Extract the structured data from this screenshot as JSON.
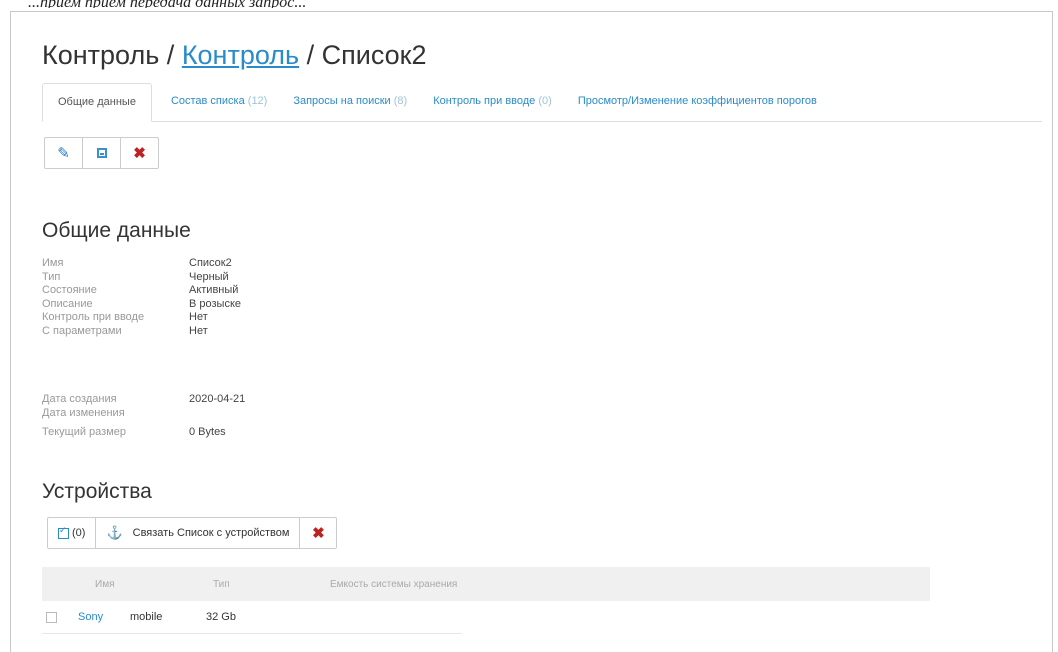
{
  "header_caption": "...прием прием передача данных запрос...",
  "breadcrumb": {
    "part1": "Контроль /",
    "link": "Контроль",
    "part3": "/ Список2"
  },
  "tabs": [
    {
      "label": "Общие данные",
      "count": ""
    },
    {
      "label": "Состав списка",
      "count": "(12)"
    },
    {
      "label": "Запросы на поиски",
      "count": "(8)"
    },
    {
      "label": "Контроль при вводе",
      "count": "(0)"
    },
    {
      "label": "Просмотр/Изменение коэффициентов порогов",
      "count": ""
    }
  ],
  "toolbar": {
    "edit_icon": "pencil-icon",
    "save_icon": "save-icon",
    "delete_icon": "close-icon"
  },
  "general": {
    "title": "Общие данные",
    "props": [
      {
        "key": "Имя",
        "value": "Список2"
      },
      {
        "key": "Тип",
        "value": "Черный"
      },
      {
        "key": "Состояние",
        "value": "Активный"
      },
      {
        "key": "Описание",
        "value": "В розыске"
      },
      {
        "key": "Контроль при вводе",
        "value": "Нет"
      },
      {
        "key": "С параметрами",
        "value": "Нет"
      }
    ],
    "dates": [
      {
        "key": "Дата создания",
        "value": "2020-04-21"
      },
      {
        "key": "Дата изменения",
        "value": ""
      },
      {
        "key": "Текущий размер",
        "value": "0 Bytes"
      }
    ]
  },
  "devices": {
    "title": "Устройства",
    "select_count": "(0)",
    "link_label": "Связать Список с устройством",
    "columns": [
      "Имя",
      "Тип",
      "Емкость системы хранения"
    ],
    "rows": [
      {
        "name": "Sony",
        "type": "mobile",
        "capacity": "32 Gb"
      }
    ]
  },
  "colors": {
    "accent": "#2a8bc9",
    "danger": "#b22222"
  }
}
